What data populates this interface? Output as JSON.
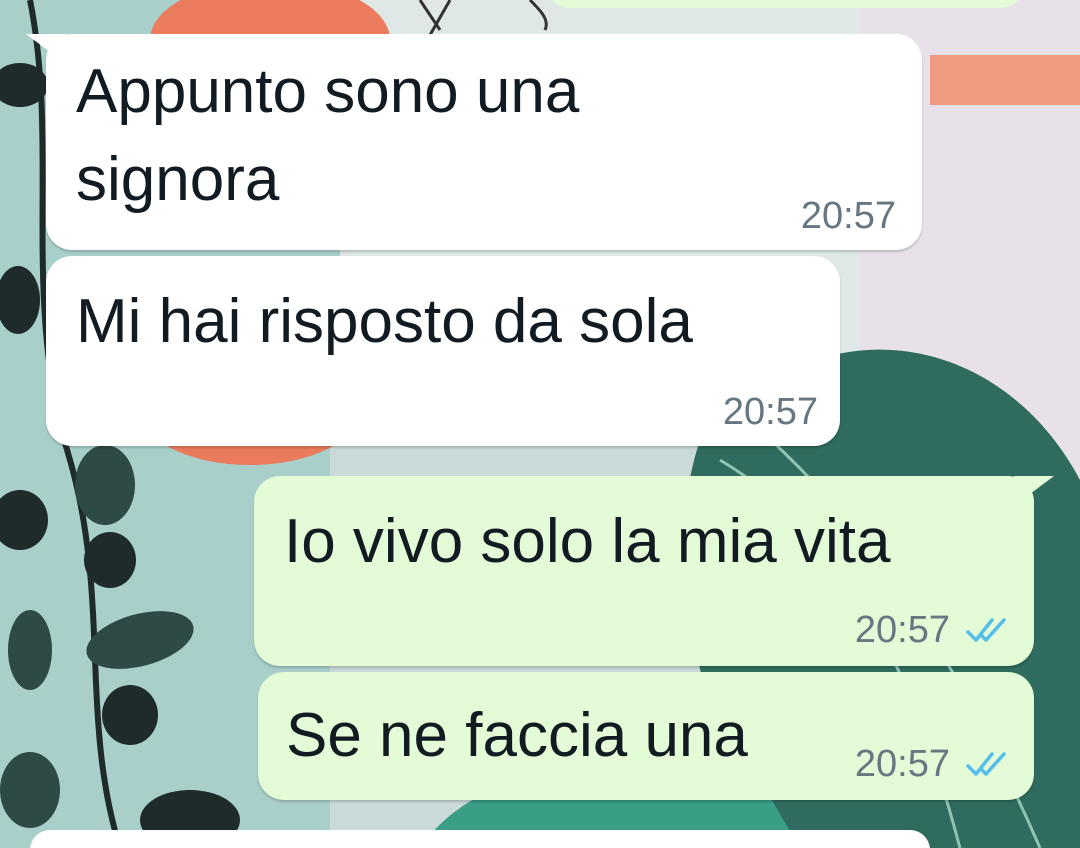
{
  "chat": {
    "messages": [
      {
        "direction": "incoming",
        "text_lines": [
          "Appunto sono una",
          "signora"
        ],
        "time": "20:57"
      },
      {
        "direction": "incoming",
        "text": "Mi hai risposto da sola",
        "time": "20:57"
      },
      {
        "direction": "outgoing",
        "text": "Io vivo solo la mia vita",
        "time": "20:57",
        "status": "read",
        "status_icon": "double-check-icon"
      },
      {
        "direction": "outgoing",
        "text": "Se ne faccia una",
        "time": "20:57",
        "status": "read",
        "status_icon": "double-check-icon"
      }
    ]
  },
  "colors": {
    "incoming_bubble": "#ffffff",
    "outgoing_bubble": "#e3fbd6",
    "text": "#111b21",
    "time": "#667781",
    "read_ticks": "#53bdeb"
  }
}
